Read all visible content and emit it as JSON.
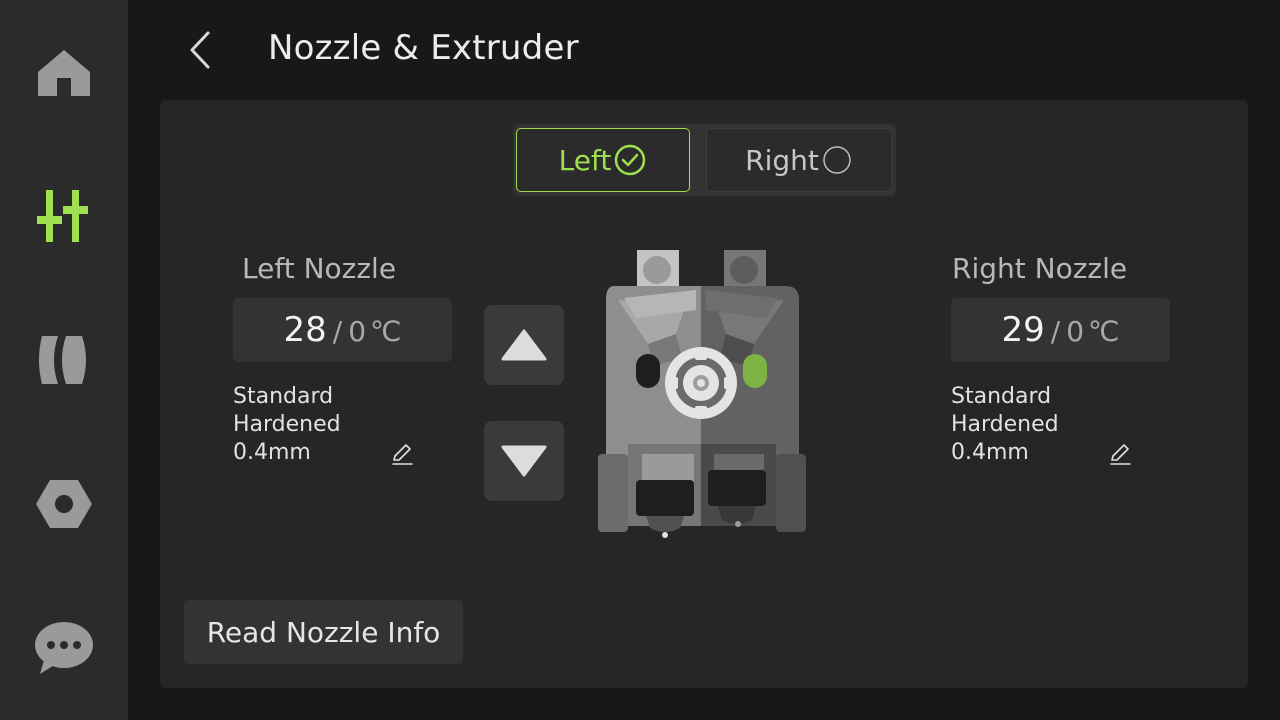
{
  "app": {
    "title": "Nozzle & Extruder",
    "accent_color": "#9ee04f"
  },
  "sidebar": {
    "items": [
      {
        "name": "home",
        "icon": "home-icon",
        "active": false
      },
      {
        "name": "controls",
        "icon": "sliders-icon",
        "active": true
      },
      {
        "name": "filament",
        "icon": "filament-spool-icon",
        "active": false
      },
      {
        "name": "settings",
        "icon": "hex-nut-icon",
        "active": false
      },
      {
        "name": "messages",
        "icon": "chat-bubble-icon",
        "active": false
      }
    ]
  },
  "header": {
    "back_icon": "chevron-left-icon",
    "title": "Nozzle & Extruder"
  },
  "selector": {
    "left_label": "Left",
    "right_label": "Right",
    "selected": "Left"
  },
  "left_nozzle": {
    "title": "Left Nozzle",
    "current_temp": "28",
    "separator": "/",
    "target_temp": "0",
    "unit": "℃",
    "type_line1": "Standard",
    "type_line2": "Hardened",
    "diameter": "0.4mm"
  },
  "right_nozzle": {
    "title": "Right Nozzle",
    "current_temp": "29",
    "separator": "/",
    "target_temp": "0",
    "unit": "℃",
    "type_line1": "Standard",
    "type_line2": "Hardened",
    "diameter": "0.4mm"
  },
  "actions": {
    "read_label": "Read Nozzle Info",
    "move_up_icon": "triangle-up-icon",
    "move_down_icon": "triangle-down-icon"
  }
}
